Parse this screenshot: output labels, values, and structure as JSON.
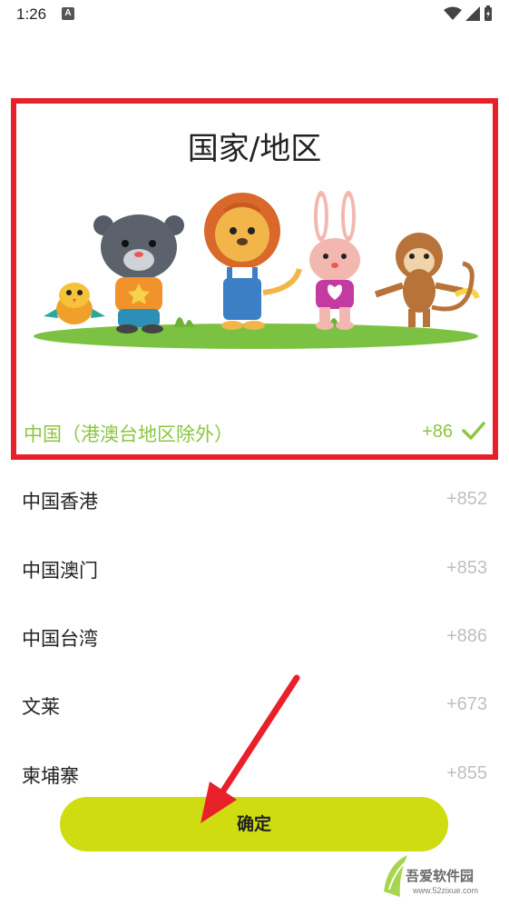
{
  "status_bar": {
    "time": "1:26",
    "notification_letter": "A"
  },
  "selector": {
    "title": "国家/地区",
    "selected": {
      "name": "中国（港澳台地区除外）",
      "code": "+86"
    }
  },
  "countries": [
    {
      "name": "中国香港",
      "code": "+852"
    },
    {
      "name": "中国澳门",
      "code": "+853"
    },
    {
      "name": "中国台湾",
      "code": "+886"
    },
    {
      "name": "文莱",
      "code": "+673"
    },
    {
      "name": "柬埔寨",
      "code": "+855"
    }
  ],
  "confirm_label": "确定",
  "watermark": {
    "brand": "吾爱软件园",
    "url": "www.52zixue.com"
  },
  "colors": {
    "accent_green": "#8cc63f",
    "button": "#cfdc12",
    "highlight_border": "#e8202a"
  }
}
